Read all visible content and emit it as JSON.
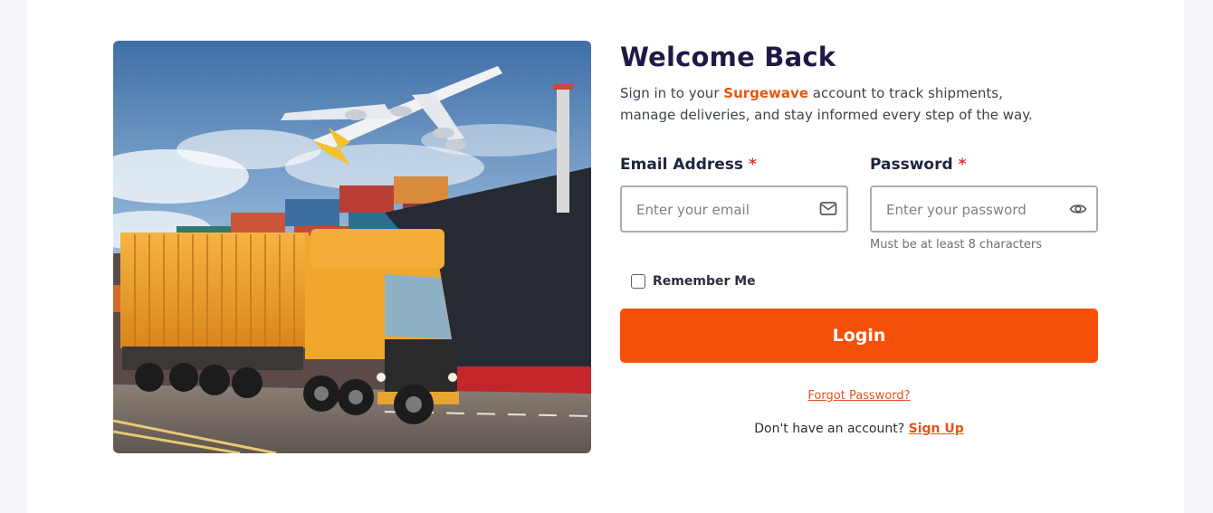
{
  "hero": {
    "image_subject": "logistics-collage: cargo plane, container ship and yellow container truck"
  },
  "form": {
    "title": "Welcome Back",
    "subtitle_before": "Sign in to your ",
    "brand_name": "Surgewave",
    "subtitle_after": " account to track shipments, manage deliveries, and stay informed every step of the way.",
    "email": {
      "label": "Email Address",
      "required_mark": "*",
      "placeholder": "Enter your email",
      "value": "",
      "icon": "mail-icon"
    },
    "password": {
      "label": "Password",
      "required_mark": "*",
      "placeholder": "Enter your password",
      "value": "",
      "icon": "eye-icon",
      "hint": "Must be at least 8 characters"
    },
    "remember_label": "Remember Me",
    "remember_checked": false,
    "login_label": "Login",
    "forgot_label": "Forgot Password?",
    "no_account_text": "Don't have an account?",
    "signup_label": "Sign Up"
  },
  "colors": {
    "accent": "#f5500a",
    "brand_text": "#e8560e",
    "title": "#1f1a45",
    "required": "#e03434"
  }
}
